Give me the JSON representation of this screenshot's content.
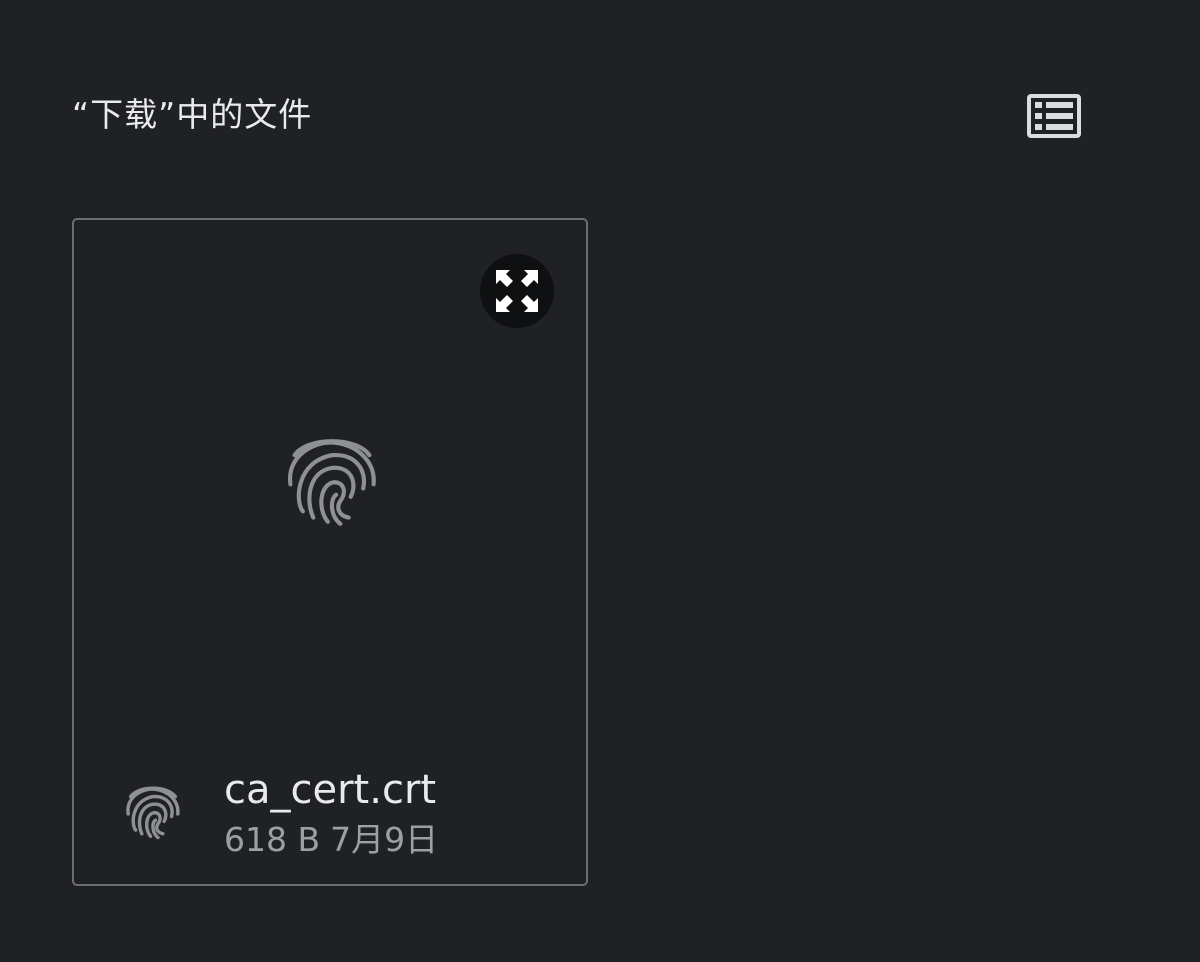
{
  "section": {
    "title": "“下载”中的文件"
  },
  "file": {
    "name": "ca_cert.crt",
    "size": "618 B",
    "date": "7月9日"
  },
  "icons": {
    "view_toggle": "list-view-icon",
    "expand": "expand-icon",
    "preview": "fingerprint-icon",
    "file_type": "fingerprint-icon"
  },
  "colors": {
    "background": "#202124",
    "card_border": "#6b6d70",
    "text_primary": "#e8eaed",
    "text_secondary": "#9aa0a6",
    "icon_gray": "#8e9093"
  }
}
